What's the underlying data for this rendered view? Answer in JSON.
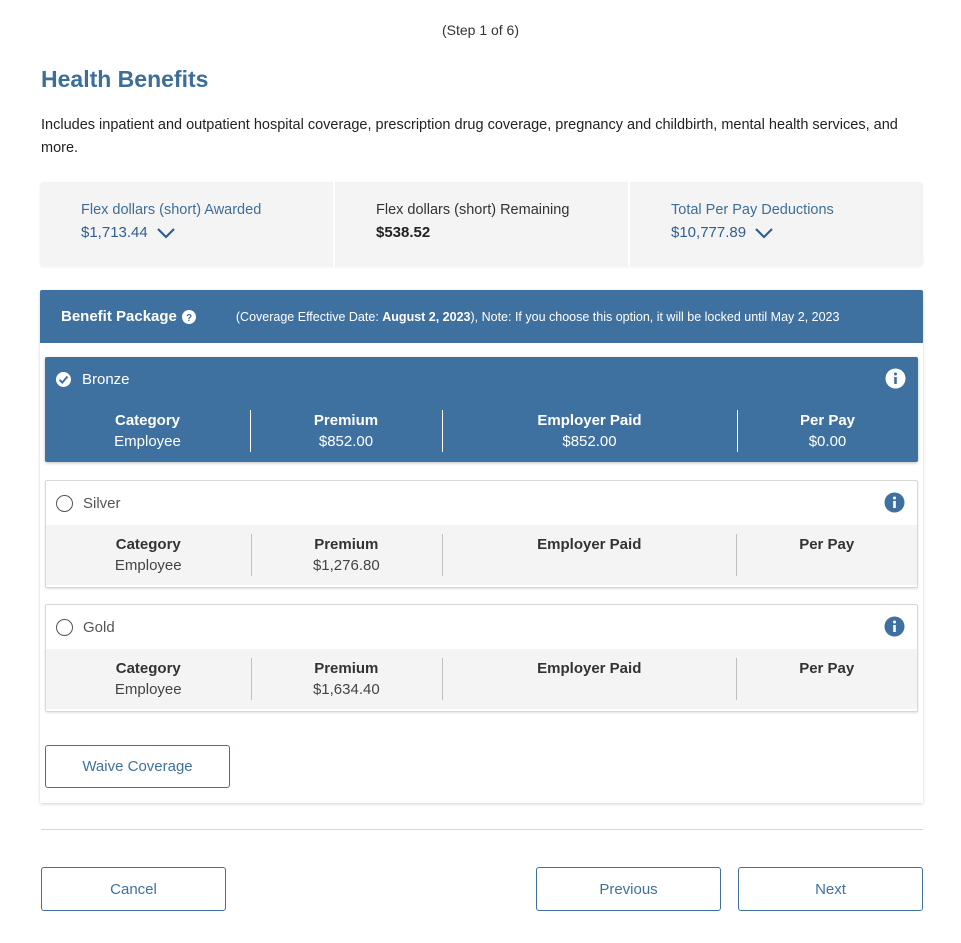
{
  "step": "(Step 1 of 6)",
  "title": "Health Benefits",
  "description": "Includes inpatient and outpatient hospital coverage, prescription drug coverage, pregnancy and childbirth, mental health services, and more.",
  "summary": {
    "awarded_label": "Flex dollars (short) Awarded",
    "awarded_value": "$1,713.44",
    "remaining_label": "Flex dollars (short) Remaining",
    "remaining_value": "$538.52",
    "deductions_label": "Total Per Pay Deductions",
    "deductions_value": "$10,777.89"
  },
  "benefit_package": {
    "title": "Benefit Package",
    "note_prefix": "(Coverage Effective Date: ",
    "effective_date": "August 2, 2023",
    "note_suffix": "), Note: If you choose this option, it will be locked until May 2, 2023"
  },
  "columns": {
    "category": "Category",
    "premium": "Premium",
    "employer_paid": "Employer Paid",
    "per_pay": "Per Pay"
  },
  "plans": [
    {
      "name": "Bronze",
      "selected": true,
      "category": "Employee",
      "premium": "$852.00",
      "employer_paid": "$852.00",
      "per_pay": "$0.00"
    },
    {
      "name": "Silver",
      "selected": false,
      "category": "Employee",
      "premium": "$1,276.80",
      "employer_paid": "",
      "per_pay": ""
    },
    {
      "name": "Gold",
      "selected": false,
      "category": "Employee",
      "premium": "$1,634.40",
      "employer_paid": "",
      "per_pay": ""
    }
  ],
  "buttons": {
    "waive": "Waive Coverage",
    "cancel": "Cancel",
    "previous": "Previous",
    "next": "Next"
  },
  "colors": {
    "primary": "#3f71a0",
    "title": "#3d6e99",
    "panel_bg": "#f4f4f4"
  }
}
